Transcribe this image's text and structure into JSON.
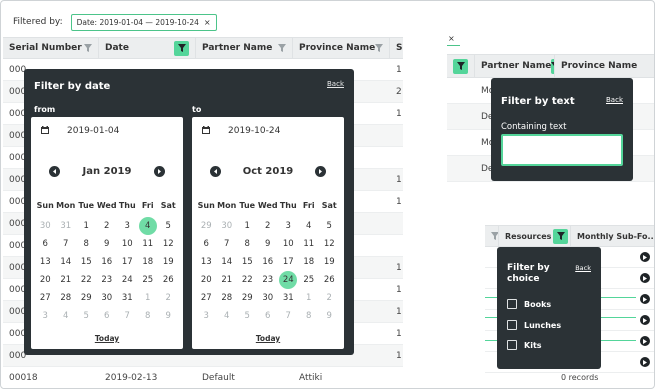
{
  "filter_bar": {
    "label": "Filtered by:",
    "chip_label": "Date: 2019-01-04 — 2019-10-24",
    "chip_close": "×"
  },
  "left_table": {
    "columns": [
      "Serial Number",
      "Date",
      "Partner Name",
      "Province Name",
      "S"
    ],
    "rows": [
      [
        "000",
        "",
        "",
        "",
        "1"
      ],
      [
        "000",
        "",
        "",
        "",
        "2"
      ],
      [
        "000",
        "",
        "",
        "",
        "1"
      ],
      [
        "000",
        "",
        "",
        "",
        ""
      ],
      [
        "000",
        "",
        "",
        "",
        ""
      ],
      [
        "000",
        "",
        "",
        "",
        "1"
      ],
      [
        "000",
        "",
        "",
        "",
        "1"
      ],
      [
        "000",
        "",
        "",
        "",
        ""
      ],
      [
        "000",
        "",
        "",
        "",
        ""
      ],
      [
        "000",
        "",
        "",
        "",
        "1"
      ],
      [
        "000",
        "",
        "",
        "",
        "1"
      ],
      [
        "000",
        "",
        "",
        "",
        "1"
      ],
      [
        "000",
        "",
        "",
        "",
        "1"
      ],
      [
        "000",
        "",
        "",
        "",
        "1"
      ],
      [
        "00018",
        "2019-02-13",
        "Default",
        "Attiki",
        ""
      ]
    ]
  },
  "date_filter": {
    "title": "Filter by date",
    "back": "Back",
    "from_label": "from",
    "to_label": "to",
    "from": {
      "date_value": "2019-01-04",
      "month_label": "Jan 2019",
      "today": "Today",
      "days_of_week": [
        "Sun",
        "Mon",
        "Tue",
        "Wed",
        "Thu",
        "Fri",
        "Sat"
      ],
      "weeks": [
        [
          "30",
          "31",
          "1",
          "2",
          "3",
          "4",
          "5"
        ],
        [
          "6",
          "7",
          "8",
          "9",
          "10",
          "11",
          "12"
        ],
        [
          "13",
          "14",
          "15",
          "16",
          "17",
          "18",
          "19"
        ],
        [
          "20",
          "21",
          "22",
          "23",
          "24",
          "25",
          "26"
        ],
        [
          "27",
          "28",
          "29",
          "30",
          "31",
          "1",
          "2"
        ],
        [
          "3",
          "4",
          "5",
          "6",
          "7",
          "8",
          "9"
        ]
      ],
      "selected": "4"
    },
    "to": {
      "date_value": "2019-10-24",
      "month_label": "Oct 2019",
      "today": "Today",
      "days_of_week": [
        "Sun",
        "Mon",
        "Tue",
        "Wed",
        "Thu",
        "Fri",
        "Sat"
      ],
      "weeks": [
        [
          "29",
          "30",
          "1",
          "2",
          "3",
          "4",
          "5"
        ],
        [
          "6",
          "7",
          "8",
          "9",
          "10",
          "11",
          "12"
        ],
        [
          "13",
          "14",
          "15",
          "16",
          "17",
          "18",
          "19"
        ],
        [
          "20",
          "21",
          "22",
          "23",
          "24",
          "25",
          "26"
        ],
        [
          "27",
          "28",
          "29",
          "30",
          "31",
          "1",
          "2"
        ],
        [
          "3",
          "4",
          "5",
          "6",
          "7",
          "8",
          "9"
        ]
      ],
      "selected": "24"
    }
  },
  "top_right": {
    "chip_close": "×",
    "columns": [
      "Partner Name",
      "Province Name"
    ],
    "rows": [
      "Mo",
      "De",
      "Mo",
      "De"
    ],
    "text_filter": {
      "title": "Filter by text",
      "back": "Back",
      "field_label": "Containing text",
      "value": ""
    }
  },
  "bottom_right": {
    "columns": [
      "Resources",
      "Monthly Sub-Fo..."
    ],
    "choice_filter": {
      "title": "Filter by choice",
      "back": "Back",
      "options": [
        "Books",
        "Lunches",
        "Kits"
      ]
    },
    "records": "0 records"
  },
  "colors": {
    "accent": "#54d59a",
    "popup_bg": "#2b3236",
    "header_bg": "#eceeef"
  }
}
